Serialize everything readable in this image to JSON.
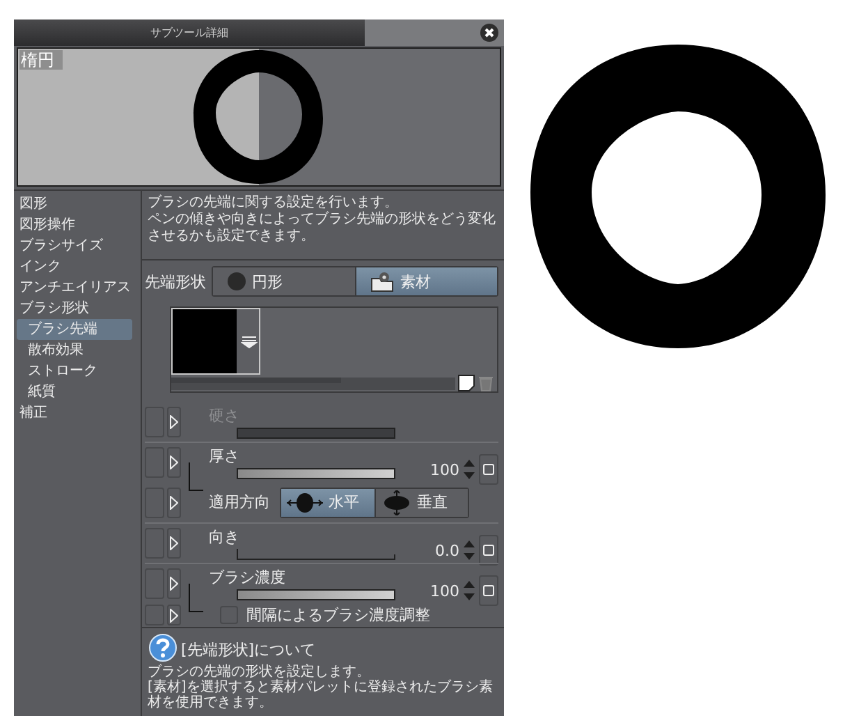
{
  "window": {
    "title": "サブツール詳細"
  },
  "preview": {
    "label": "楕円"
  },
  "categories": [
    {
      "label": "図形",
      "selected": false
    },
    {
      "label": "図形操作",
      "selected": false
    },
    {
      "label": "ブラシサイズ",
      "selected": false
    },
    {
      "label": "インク",
      "selected": false
    },
    {
      "label": "アンチエイリアス",
      "selected": false
    },
    {
      "label": "ブラシ形状",
      "selected": false,
      "children": [
        {
          "label": "ブラシ先端",
          "selected": true
        },
        {
          "label": "散布効果",
          "selected": false
        },
        {
          "label": "ストローク",
          "selected": false
        },
        {
          "label": "紙質",
          "selected": false
        }
      ]
    },
    {
      "label": "補正",
      "selected": false
    }
  ],
  "description": [
    "ブラシの先端に関する設定を行います。",
    "ペンの傾きや向きによってブラシ先端の形状をどう変化させるかも設定できます。"
  ],
  "tip_shape": {
    "label": "先端形状",
    "options": [
      {
        "kind": "circle",
        "label": "円形",
        "selected": false
      },
      {
        "kind": "material",
        "label": "素材",
        "selected": true
      }
    ]
  },
  "settings": [
    {
      "kind": "slider",
      "label": "硬さ",
      "disabled": true
    },
    {
      "kind": "slider",
      "label": "厚さ",
      "disabled": false,
      "level": 1,
      "value": "100",
      "children": [
        {
          "kind": "direction",
          "label": "適用方向",
          "options": [
            {
              "kind": "horizontal",
              "label": "水平",
              "selected": true
            },
            {
              "kind": "vertical",
              "label": "垂直",
              "selected": false
            }
          ]
        }
      ]
    },
    {
      "kind": "angle",
      "label": "向き",
      "disabled": false,
      "value": "0.0"
    },
    {
      "kind": "slider",
      "label": "ブラシ濃度",
      "disabled": false,
      "level": 1,
      "value": "100",
      "children": [
        {
          "kind": "checkbox",
          "label": "間隔によるブラシ濃度調整",
          "checked": false
        }
      ]
    }
  ],
  "help": {
    "title": "[先端形状]について",
    "body": [
      "ブラシの先端の形状を設定します。",
      "[素材]を選択すると素材パレットに登録されたブラシ素材を使用できます。"
    ]
  }
}
